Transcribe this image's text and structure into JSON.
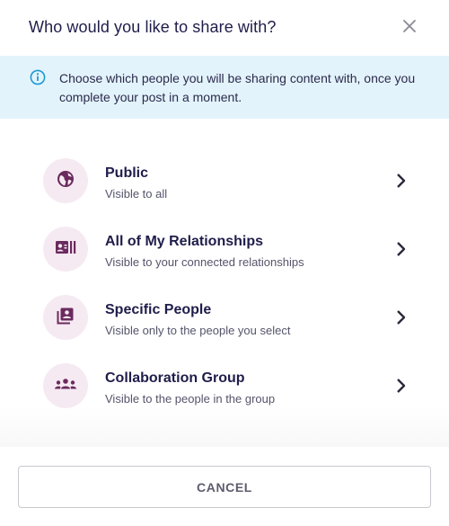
{
  "dialog": {
    "title": "Who would you like to share with?",
    "close_icon": "close-icon"
  },
  "banner": {
    "icon": "info-icon",
    "text": "Choose which people you will be sharing content with, once you complete your post in a moment."
  },
  "options": [
    {
      "title": "Public",
      "subtitle": "Visible to all",
      "icon": "globe-icon"
    },
    {
      "title": "All of My Relationships",
      "subtitle": "Visible to your connected relationships",
      "icon": "contact-card-icon"
    },
    {
      "title": "Specific People",
      "subtitle": "Visible only to the people you select",
      "icon": "person-list-icon"
    },
    {
      "title": "Collaboration Group",
      "subtitle": "Visible to the people in the group",
      "icon": "group-icon"
    }
  ],
  "footer": {
    "cancel_label": "CANCEL"
  },
  "colors": {
    "title": "#1f1d4a",
    "banner_bg": "#e3f3fb",
    "info_blue": "#1b9ad6",
    "icon_circle_bg": "#f6eaf2",
    "icon_purple": "#6b2a5e"
  }
}
